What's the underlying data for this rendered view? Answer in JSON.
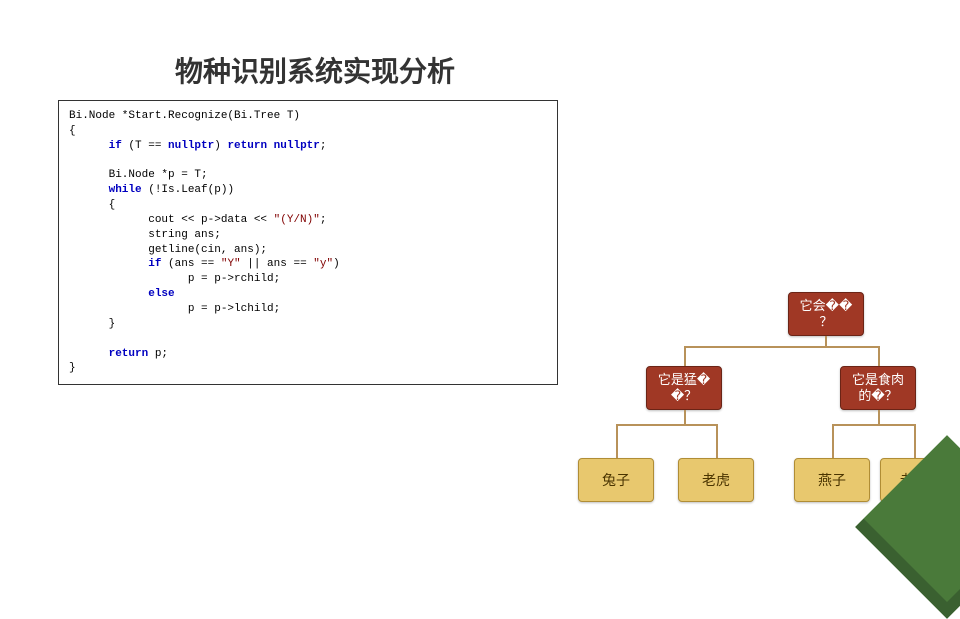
{
  "title": "物种识别系统实现分析",
  "code": {
    "sig": "Bi.Node *Start.Recognize(Bi.Tree T)",
    "open": "{",
    "l1a": "if",
    "l1b": " (T == ",
    "l1c": "nullptr",
    "l1d": ") ",
    "l1e": "return",
    "l1f": " nullptr",
    "l1g": ";",
    "l2": "Bi.Node *p = T;",
    "l3a": "while",
    "l3b": " (!Is.Leaf(p))",
    "l3c": "{",
    "l4a": "cout << p->data << ",
    "l4b": "\"(Y/N)\"",
    "l4c": ";",
    "l5": "string ans;",
    "l6": "getline(cin, ans);",
    "l7a": "if",
    "l7b": " (ans == ",
    "l7c": "\"Y\"",
    "l7d": " || ans == ",
    "l7e": "\"y\"",
    "l7f": ")",
    "l8": "p = p->rchild;",
    "l9a": "else",
    "l10": "p = p->lchild;",
    "l11": "}",
    "l12a": "return",
    "l12b": " p;",
    "close": "}"
  },
  "tree": {
    "root": "它会��\n？",
    "left": "它是猛�\n�？",
    "right": "它是食肉\n的�？",
    "leaf1": "兔子",
    "leaf2": "老虎",
    "leaf3": "燕子",
    "leaf4": "老�"
  }
}
